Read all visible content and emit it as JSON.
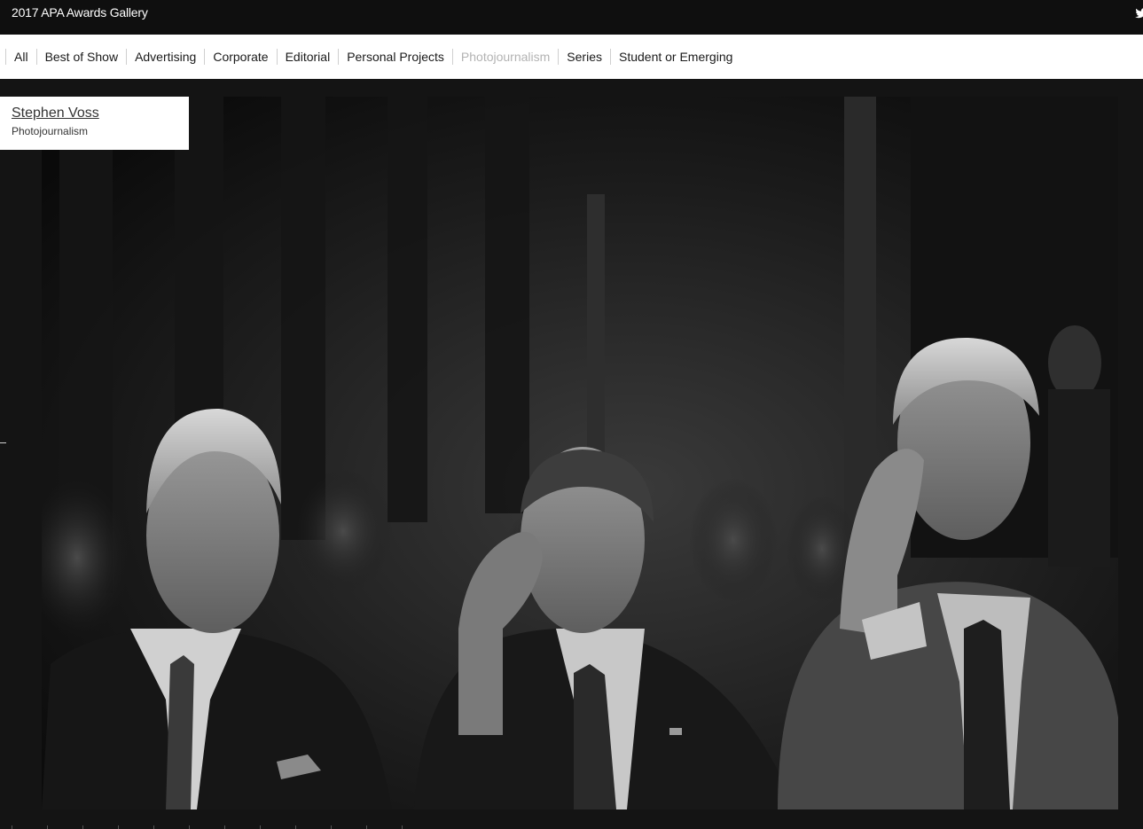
{
  "header": {
    "title": "2017 APA Awards Gallery",
    "social_icon": "twitter-icon"
  },
  "nav": {
    "items": [
      {
        "label": "All",
        "active": false
      },
      {
        "label": "Best of Show",
        "active": false
      },
      {
        "label": "Advertising",
        "active": false
      },
      {
        "label": "Corporate",
        "active": false
      },
      {
        "label": "Editorial",
        "active": false
      },
      {
        "label": "Personal Projects",
        "active": false
      },
      {
        "label": "Photojournalism",
        "active": true
      },
      {
        "label": "Series",
        "active": false
      },
      {
        "label": "Student or Emerging",
        "active": false
      }
    ]
  },
  "credit": {
    "photographer": "Stephen Voss",
    "category": "Photojournalism"
  },
  "colors": {
    "topbar": "#0f0f0f",
    "page_background": "#141414",
    "nav_background": "#ffffff",
    "nav_active_text": "#b3b3b3"
  }
}
